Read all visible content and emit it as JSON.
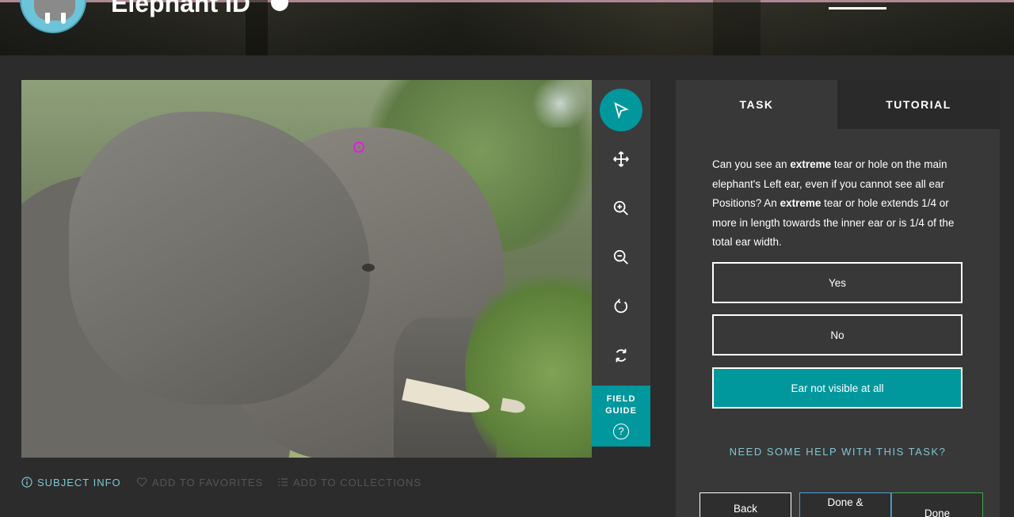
{
  "header": {
    "project_title": "Elephant ID"
  },
  "toolbar": {
    "tools": [
      {
        "name": "pointer",
        "icon": "cursor-arrow-icon",
        "active": true
      },
      {
        "name": "move",
        "icon": "move-arrows-icon",
        "active": false
      },
      {
        "name": "zoom-in",
        "icon": "zoom-in-icon",
        "active": false
      },
      {
        "name": "zoom-out",
        "icon": "zoom-out-icon",
        "active": false
      },
      {
        "name": "rotate",
        "icon": "rotate-icon",
        "active": false
      },
      {
        "name": "reset",
        "icon": "reset-icon",
        "active": false
      }
    ],
    "field_guide_label": "FIELD GUIDE",
    "field_guide_icon": "?"
  },
  "metadata": {
    "subject_info": "SUBJECT INFO",
    "add_to_favorites": "ADD TO FAVORITES",
    "add_to_collections": "ADD TO COLLECTIONS"
  },
  "task_panel": {
    "tabs": [
      "TASK",
      "TUTORIAL"
    ],
    "active_tab": "TASK",
    "question_parts": {
      "p1": "Can you see an ",
      "b1": "extreme",
      "p2": " tear or hole on the main elephant's Left ear, even if you cannot see all ear Positions? An ",
      "b2": "extreme",
      "p3": " tear or hole extends 1/4 or more in length towards the inner ear or is 1/4 of the total ear width."
    },
    "answers": [
      "Yes",
      "No",
      "Ear not visible at all"
    ],
    "selected_answer": "Ear not visible at all",
    "help_link": "NEED SOME HELP WITH THIS TASK?",
    "buttons": {
      "back": "Back",
      "done_and_talk": "Done &",
      "done": "Done"
    }
  },
  "colors": {
    "accent_teal": "#00979d",
    "link_blue": "#7fc7d3",
    "marker_magenta": "#e020e0",
    "talk_border": "#4aa2d8",
    "done_border": "#41a64a"
  }
}
